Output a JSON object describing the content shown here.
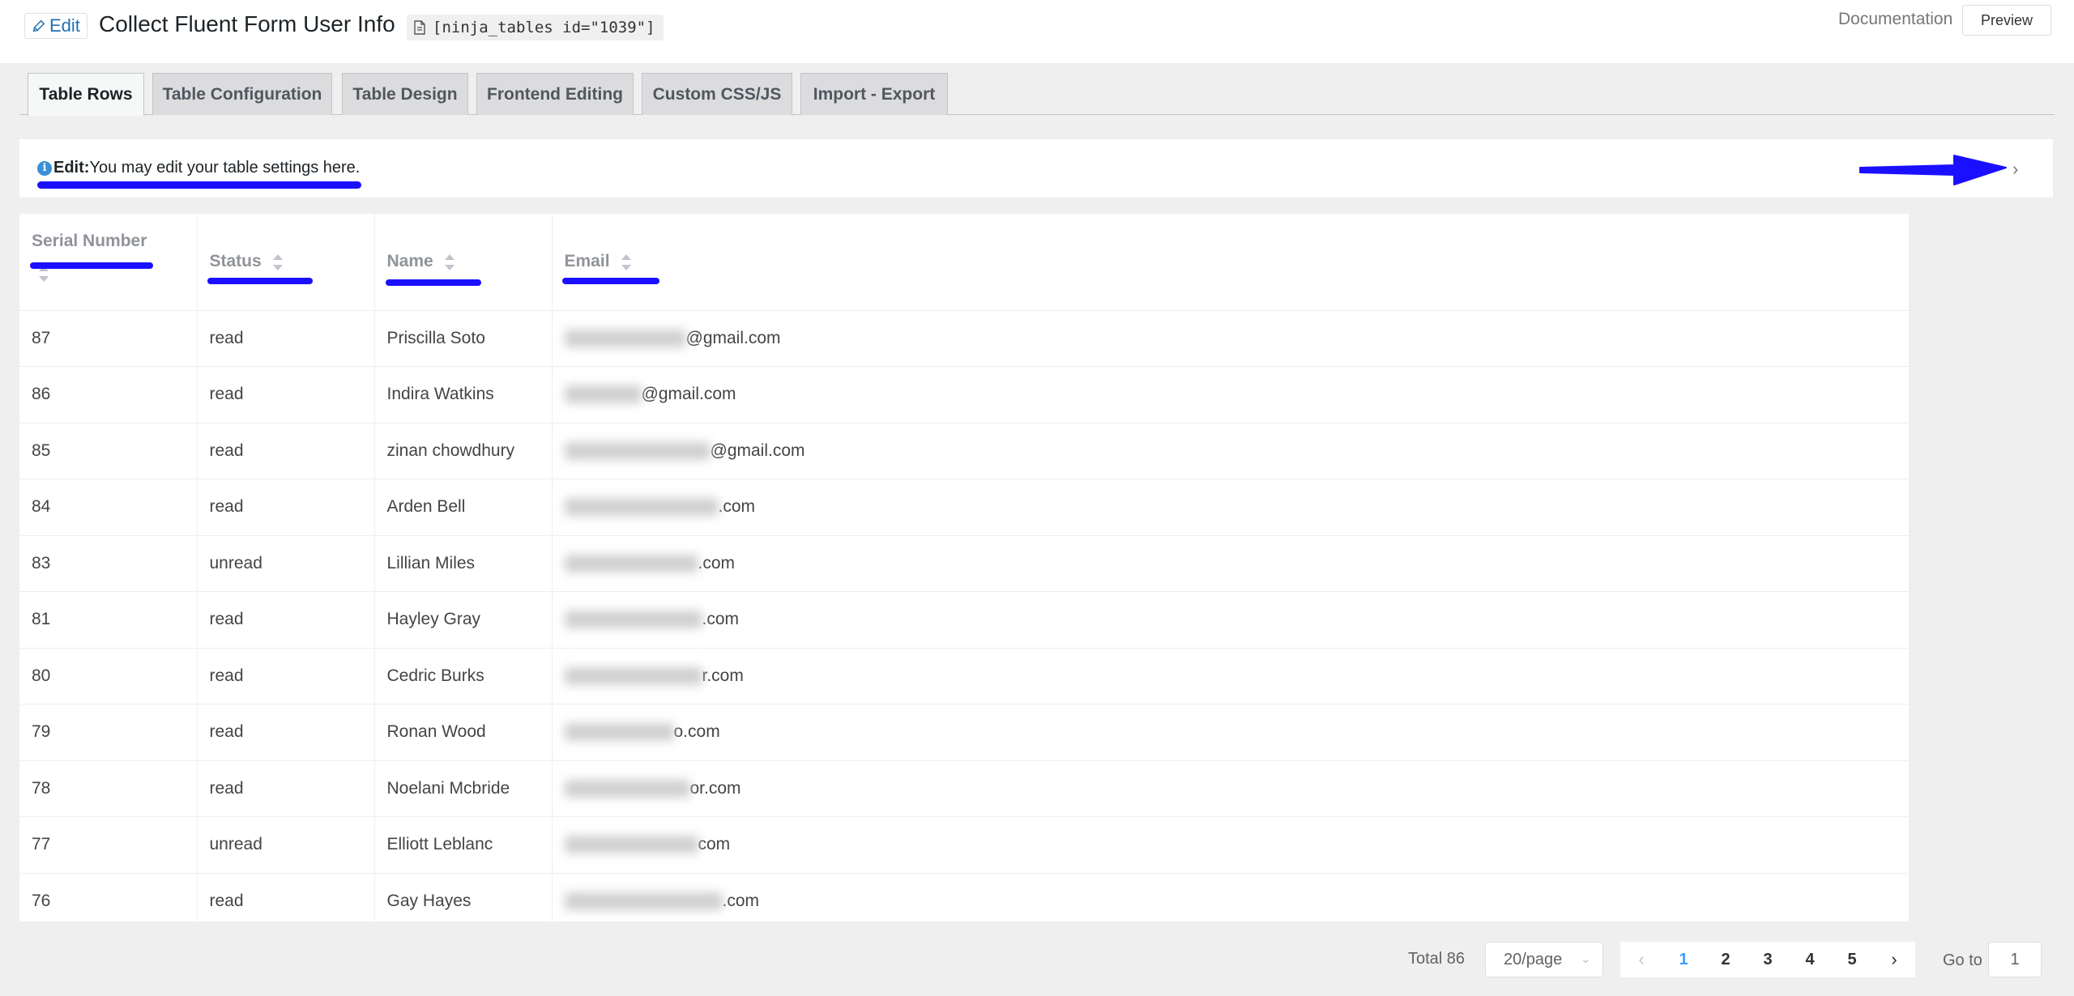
{
  "header": {
    "edit_label": "Edit",
    "title": "Collect Fluent Form User Info",
    "shortcode": "[ninja_tables id=\"1039\"]",
    "documentation_label": "Documentation",
    "preview_label": "Preview"
  },
  "tabs": [
    {
      "label": "Table Rows",
      "active": true
    },
    {
      "label": "Table Configuration",
      "active": false
    },
    {
      "label": "Table Design",
      "active": false
    },
    {
      "label": "Frontend Editing",
      "active": false
    },
    {
      "label": "Custom CSS/JS",
      "active": false
    },
    {
      "label": "Import - Export",
      "active": false
    }
  ],
  "notice": {
    "prefix": "Edit:",
    "text": "You may edit your table settings here."
  },
  "table": {
    "columns": [
      "Serial Number",
      "Status",
      "Name",
      "Email"
    ],
    "rows": [
      {
        "serial": "87",
        "status": "read",
        "name": "Priscilla Soto",
        "email_visible": "@gmail.com"
      },
      {
        "serial": "86",
        "status": "read",
        "name": "Indira Watkins",
        "email_visible": "@gmail.com"
      },
      {
        "serial": "85",
        "status": "read",
        "name": "zinan chowdhury",
        "email_visible": "@gmail.com"
      },
      {
        "serial": "84",
        "status": "read",
        "name": "Arden Bell",
        "email_visible": ".com"
      },
      {
        "serial": "83",
        "status": "unread",
        "name": "Lillian Miles",
        "email_visible": ".com"
      },
      {
        "serial": "81",
        "status": "read",
        "name": "Hayley Gray",
        "email_visible": ".com"
      },
      {
        "serial": "80",
        "status": "read",
        "name": "Cedric Burks",
        "email_visible": "r.com"
      },
      {
        "serial": "79",
        "status": "read",
        "name": "Ronan Wood",
        "email_visible": "o.com"
      },
      {
        "serial": "78",
        "status": "read",
        "name": "Noelani Mcbride",
        "email_visible": "or.com"
      },
      {
        "serial": "77",
        "status": "unread",
        "name": "Elliott Leblanc",
        "email_visible": "com"
      },
      {
        "serial": "76",
        "status": "read",
        "name": "Gay Hayes",
        "email_visible": ".com"
      }
    ]
  },
  "pagination": {
    "total_label": "Total 86",
    "page_size": "20/page",
    "pages": [
      "1",
      "2",
      "3",
      "4",
      "5"
    ],
    "current_page": "1",
    "prev_icon": "chevron-left-icon",
    "next_icon": "chevron-right-icon",
    "goto_label": "Go to",
    "goto_value": "1"
  },
  "colors": {
    "annotation": "#1a10ff",
    "link": "#2271b1",
    "active_page": "#409eff"
  }
}
